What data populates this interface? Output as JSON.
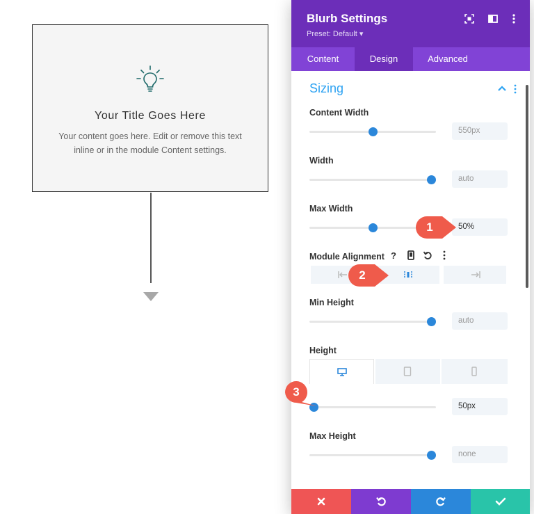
{
  "preview": {
    "title": "Your Title Goes Here",
    "content": "Your content goes here. Edit or remove this text inline or in the module Content settings.",
    "icon": "lightbulb-icon"
  },
  "panel": {
    "title": "Blurb Settings",
    "preset": "Preset: Default ▾",
    "header_icons": [
      "fullscreen-icon",
      "split-view-icon",
      "kebab-menu-icon"
    ],
    "tabs": [
      {
        "label": "Content",
        "active": false
      },
      {
        "label": "Design",
        "active": true
      },
      {
        "label": "Advanced",
        "active": false
      }
    ],
    "section": {
      "title": "Sizing",
      "expanded": true
    },
    "fields": {
      "content_width": {
        "label": "Content Width",
        "value": "550px",
        "level": 0.5
      },
      "width": {
        "label": "Width",
        "value": "auto",
        "level": 1.0
      },
      "max_width": {
        "label": "Max Width",
        "value": "50%",
        "level": 0.5
      },
      "module_alignment": {
        "label": "Module Alignment",
        "icons": [
          "help-icon",
          "responsive-device-icon",
          "reset-icon",
          "kebab-menu-icon"
        ],
        "options": [
          "align-left",
          "align-center",
          "align-right"
        ],
        "selected": "align-center"
      },
      "min_height": {
        "label": "Min Height",
        "value": "auto",
        "level": 1.0
      },
      "height": {
        "label": "Height",
        "value": "50px",
        "level": 0.0,
        "devices": [
          "desktop",
          "tablet",
          "phone"
        ],
        "active_device": "desktop"
      },
      "max_height": {
        "label": "Max Height",
        "value": "none",
        "level": 1.0
      }
    },
    "footer": [
      "cancel",
      "undo",
      "redo",
      "save"
    ]
  },
  "callouts": [
    "1",
    "2",
    "3"
  ],
  "colors": {
    "header": "#6c2eb9",
    "tabs": "#8143d6",
    "accent": "#2ea3f2",
    "slider_handle": "#2b87da",
    "cancel": "#ef5555",
    "undo": "#7e3bd0",
    "redo": "#2b87da",
    "save": "#29c4a9",
    "callout": "#ef5b4b"
  }
}
